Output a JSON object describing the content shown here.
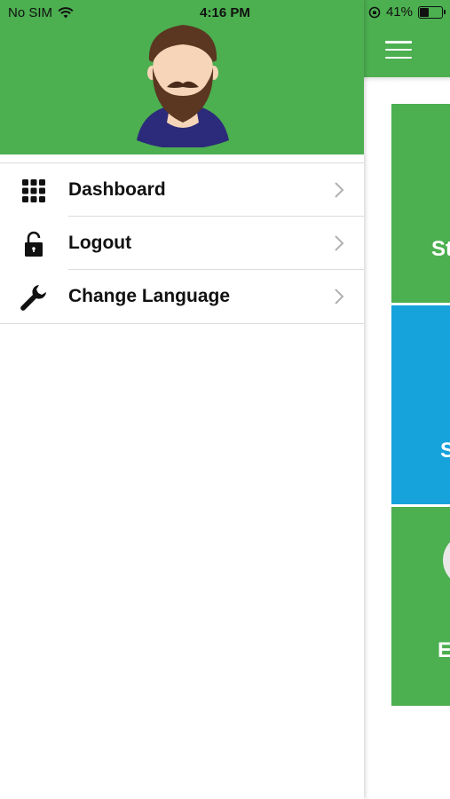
{
  "status_bar": {
    "carrier": "No SIM",
    "time": "4:16 PM",
    "battery": "41%",
    "battery_level": 0.41
  },
  "drawer": {
    "menu": [
      {
        "label": "Dashboard",
        "icon": "grid-icon"
      },
      {
        "label": "Logout",
        "icon": "lock-icon"
      },
      {
        "label": "Change Language",
        "icon": "wrench-icon"
      }
    ]
  },
  "main": {
    "tiles": [
      {
        "partial_label": "St",
        "color": "#4caf50"
      },
      {
        "partial_label": "S",
        "color": "#16a3db"
      },
      {
        "partial_label": "E",
        "color": "#4caf50"
      }
    ]
  },
  "colors": {
    "primary": "#4caf50",
    "accent": "#16a3db"
  }
}
